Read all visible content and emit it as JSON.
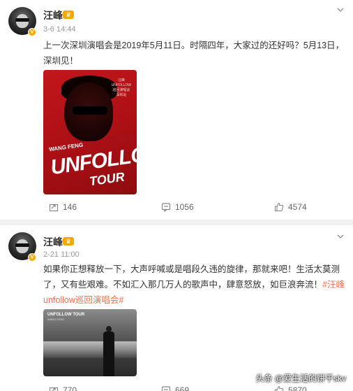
{
  "posts": [
    {
      "author": "汪峰",
      "time": "3-6 14:44",
      "text": "上一次深圳演唱会是2019年5月11日。时隔四年，大家过的还好吗？5月13日，深圳见！",
      "poster": {
        "small_lines": [
          "汪峰",
          "UNFOLLOW",
          "巡回演唱会",
          "深圳站"
        ],
        "brand": "WANG FENG",
        "title": "UNFOLLOW",
        "subtitle": "TOUR"
      },
      "reposts": "146",
      "comments": "1056",
      "likes": "4574"
    },
    {
      "author": "汪峰",
      "time": "2-21 11:00",
      "text_before": "如果你正想释放一下，大声呼喊或是唱段久违的旋律，那就来吧！生活太莫测了，又有些艰难。不如汇入那几万人的歌声中，肆意怒放，如巨浪奔流！",
      "hashtag": "#汪峰unfollow巡回演唱会#",
      "poster": {
        "title": "UNFOLLOW TOUR",
        "name": "WANG FENG"
      },
      "reposts": "770",
      "comments": "669",
      "likes": "5870"
    }
  ],
  "watermark": "头条 @爱生活的饼干skv",
  "colors": {
    "vip": "#f7a800",
    "hashtag": "#eb7350",
    "meta": "#999999"
  }
}
